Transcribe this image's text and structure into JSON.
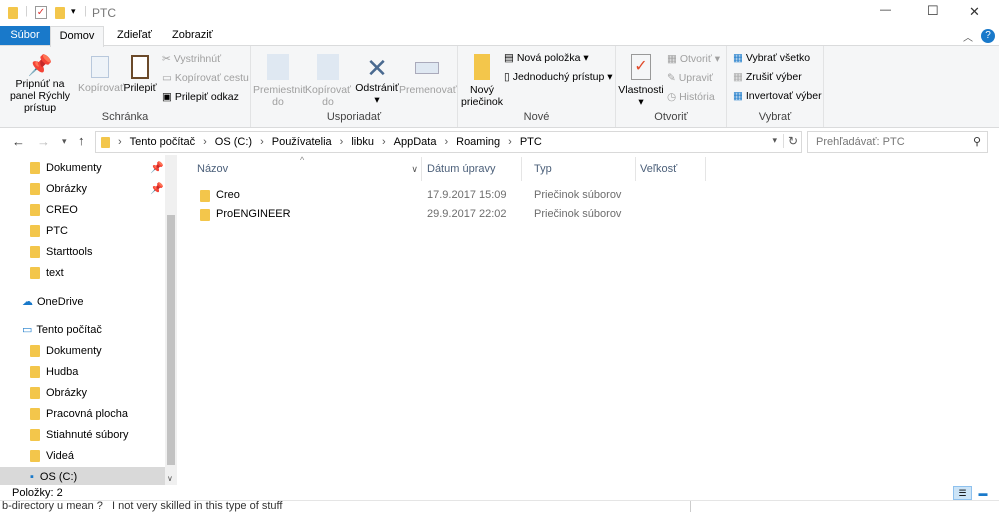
{
  "window": {
    "title": "PTC",
    "minimize": "—",
    "maximize": "☐",
    "close": "✕"
  },
  "tabs": [
    {
      "label": "Súbor"
    },
    {
      "label": "Domov"
    },
    {
      "label": "Zdieľať"
    },
    {
      "label": "Zobraziť"
    }
  ],
  "ribbon": {
    "clipboard": {
      "label": "Schránka",
      "pin": "Pripnúť na panel Rýchly prístup",
      "copy": "Kopírovať",
      "paste": "Prilepiť",
      "cut": "Vystrihnúť",
      "copy_path": "Kopírovať cestu",
      "paste_shortcut": "Prilepiť odkaz"
    },
    "organize": {
      "label": "Usporiadať",
      "move": "Premiestniť do",
      "copy_to": "Kopírovať do",
      "delete": "Odstrániť",
      "rename": "Premenovať"
    },
    "new": {
      "label": "Nové",
      "new_folder": "Nový priečinok",
      "new_item": "Nová položka",
      "easy_access": "Jednoduchý prístup"
    },
    "open": {
      "label": "Otvoriť",
      "properties": "Vlastnosti",
      "open": "Otvoriť",
      "edit": "Upraviť",
      "history": "História"
    },
    "select": {
      "label": "Vybrať",
      "select_all": "Vybrať všetko",
      "select_none": "Zrušiť výber",
      "invert": "Invertovať výber"
    }
  },
  "address": {
    "crumbs": [
      "Tento počítač",
      "OS (C:)",
      "Používatelia",
      "libku",
      "AppData",
      "Roaming",
      "PTC"
    ]
  },
  "search": {
    "placeholder": "Prehľadávať: PTC"
  },
  "nav": [
    {
      "label": "Dokumenty",
      "pinned": true
    },
    {
      "label": "Obrázky",
      "pinned": true
    },
    {
      "label": "CREO"
    },
    {
      "label": "PTC"
    },
    {
      "label": "Starttools"
    },
    {
      "label": "text"
    },
    {
      "label": "OneDrive"
    },
    {
      "label": "Tento počítač"
    },
    {
      "label": "Dokumenty"
    },
    {
      "label": "Hudba"
    },
    {
      "label": "Obrázky"
    },
    {
      "label": "Pracovná plocha"
    },
    {
      "label": "Stiahnuté súbory"
    },
    {
      "label": "Videá"
    },
    {
      "label": "OS (C:)"
    }
  ],
  "columns": [
    "Názov",
    "Dátum úpravy",
    "Typ",
    "Veľkosť"
  ],
  "files": [
    {
      "name": "Creo",
      "date": "17.9.2017 15:09",
      "type": "Priečinok súborov",
      "size": ""
    },
    {
      "name": "ProENGINEER",
      "date": "29.9.2017 22:02",
      "type": "Priečinok súborov",
      "size": ""
    }
  ],
  "status": {
    "items": "Položky: 2"
  },
  "background_text": "b-directory u mean ?   I not very skilled in this type of stuff"
}
